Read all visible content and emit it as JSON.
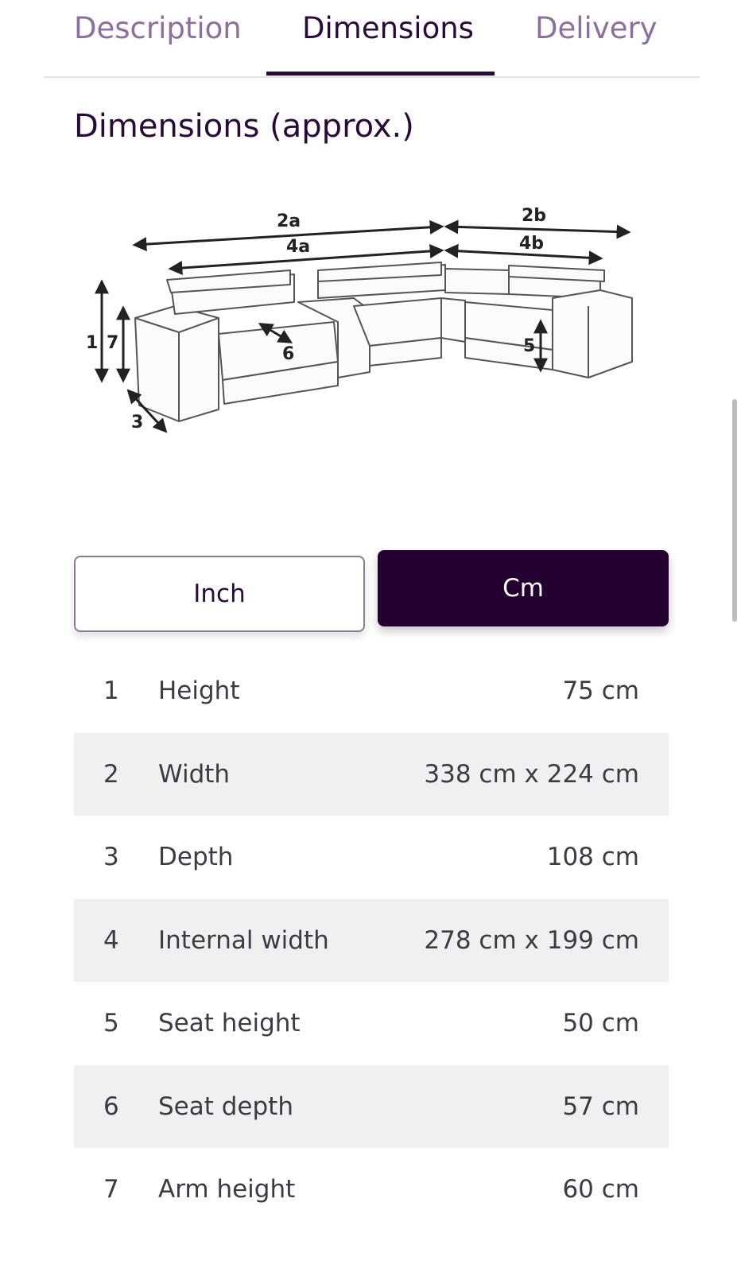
{
  "tabs": [
    {
      "label": "Description"
    },
    {
      "label": "Dimensions"
    },
    {
      "label": "Delivery"
    }
  ],
  "active_tab": "Dimensions",
  "section_title": "Dimensions (approx.)",
  "diagram": {
    "labels": {
      "l1": "1",
      "l7": "7",
      "l3": "3",
      "l6": "6",
      "l5": "5",
      "l2a": "2a",
      "l4a": "4a",
      "l2b": "2b",
      "l4b": "4b"
    }
  },
  "units": {
    "inch_label": "Inch",
    "cm_label": "Cm",
    "selected": "Cm"
  },
  "dimensions": [
    {
      "num": "1",
      "label": "Height",
      "value": "75 cm"
    },
    {
      "num": "2",
      "label": "Width",
      "value": "338 cm x 224 cm"
    },
    {
      "num": "3",
      "label": "Depth",
      "value": "108 cm"
    },
    {
      "num": "4",
      "label": "Internal width",
      "value": "278 cm x 199 cm"
    },
    {
      "num": "5",
      "label": "Seat height",
      "value": "50 cm"
    },
    {
      "num": "6",
      "label": "Seat depth",
      "value": "57 cm"
    },
    {
      "num": "7",
      "label": "Arm height",
      "value": "60 cm"
    }
  ],
  "colors": {
    "brand_dark": "#240030",
    "tab_inactive": "#8c6f9f",
    "row_stripe": "#f0f0f0"
  }
}
